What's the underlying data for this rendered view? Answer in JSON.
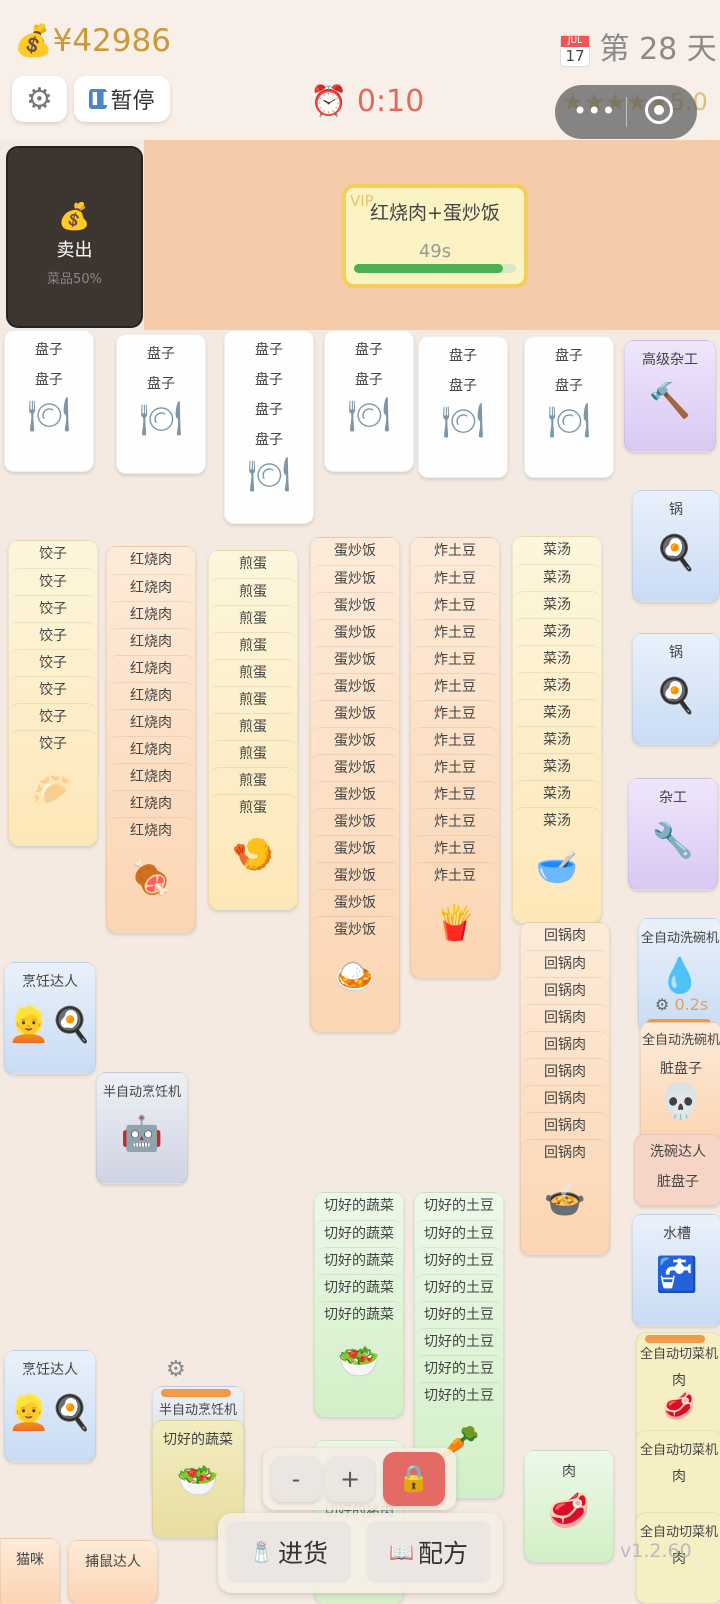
{
  "header": {
    "money": "¥42986",
    "day": "第 28 天",
    "calendar_month": "JUL",
    "calendar_day": "17",
    "pause_label": "暂停",
    "timer": "0:10",
    "rating": "5.0"
  },
  "sell": {
    "title": "卖出",
    "subtitle": "菜品50%"
  },
  "order": {
    "badge": "VIP",
    "name": "红烧肉+蛋炒饭",
    "time": "49s",
    "progress": 0.92
  },
  "cards": {
    "plate": "盘子",
    "senior_handyman": "高级杂工",
    "pot": "锅",
    "handyman": "杂工",
    "dumpling": "饺子",
    "braised_pork": "红烧肉",
    "fried_egg": "煎蛋",
    "egg_fried_rice": "蛋炒饭",
    "fried_potato": "炸土豆",
    "veg_soup": "菜汤",
    "twice_cooked_pork": "回锅肉",
    "cut_veg": "切好的蔬菜",
    "cut_potato": "切好的土豆",
    "cut_pork": "切好的猪肉",
    "meat": "肉",
    "cooking_master": "烹饪达人",
    "semi_cooker": "半自动烹饪机",
    "auto_dishwasher": "全自动洗碗机",
    "dirty_plate": "脏盘子",
    "dish_master": "洗碗达人",
    "sink": "水槽",
    "auto_cutter": "全自动切菜机",
    "cat": "猫咪",
    "mouse_catcher": "捕鼠达人",
    "washer_time": "0.2s"
  },
  "controls": {
    "minus": "-",
    "plus": "+",
    "restock": "进货",
    "recipe": "配方"
  },
  "version": "v1.2.60"
}
